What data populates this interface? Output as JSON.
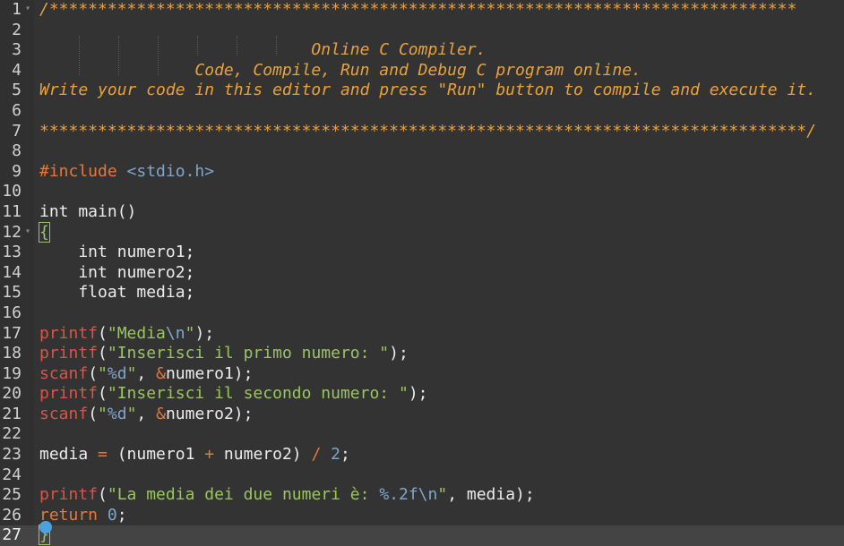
{
  "lines": [
    {
      "n": "1",
      "fold": true,
      "tokens": [
        {
          "t": "/*****************************************************************************",
          "c": "comment"
        }
      ]
    },
    {
      "n": "2",
      "tokens": []
    },
    {
      "n": "3",
      "tokens": [
        {
          "t": "                            Online C Compiler.",
          "c": "comment"
        }
      ]
    },
    {
      "n": "4",
      "tokens": [
        {
          "t": "                Code, Compile, Run and Debug C program online.",
          "c": "comment"
        }
      ]
    },
    {
      "n": "5",
      "tokens": [
        {
          "t": "Write your code in this editor and press \"Run\" button to compile and execute it.",
          "c": "comment"
        }
      ]
    },
    {
      "n": "6",
      "tokens": []
    },
    {
      "n": "7",
      "tokens": [
        {
          "t": "*******************************************************************************/",
          "c": "comment"
        }
      ]
    },
    {
      "n": "8",
      "tokens": []
    },
    {
      "n": "9",
      "tokens": [
        {
          "t": "#include ",
          "c": "pre"
        },
        {
          "t": "<stdio.h>",
          "c": "inc"
        }
      ]
    },
    {
      "n": "10",
      "tokens": []
    },
    {
      "n": "11",
      "tokens": [
        {
          "t": "int main()",
          "c": "plain"
        }
      ]
    },
    {
      "n": "12",
      "fold": true,
      "tokens": [
        {
          "t": "{",
          "c": "brace-g"
        }
      ]
    },
    {
      "n": "13",
      "tokens": [
        {
          "t": "    int numero1;",
          "c": "plain"
        }
      ]
    },
    {
      "n": "14",
      "tokens": [
        {
          "t": "    int numero2;",
          "c": "plain"
        }
      ]
    },
    {
      "n": "15",
      "tokens": [
        {
          "t": "    float media;",
          "c": "plain"
        }
      ]
    },
    {
      "n": "16",
      "tokens": []
    },
    {
      "n": "17",
      "tokens": [
        {
          "t": "printf",
          "c": "fn"
        },
        {
          "t": "(",
          "c": "plain"
        },
        {
          "t": "\"Media",
          "c": "str"
        },
        {
          "t": "\\n",
          "c": "esc"
        },
        {
          "t": "\"",
          "c": "str"
        },
        {
          "t": ");",
          "c": "plain"
        }
      ]
    },
    {
      "n": "18",
      "tokens": [
        {
          "t": "printf",
          "c": "fn"
        },
        {
          "t": "(",
          "c": "plain"
        },
        {
          "t": "\"Inserisci il primo numero: \"",
          "c": "str"
        },
        {
          "t": ");",
          "c": "plain"
        }
      ]
    },
    {
      "n": "19",
      "tokens": [
        {
          "t": "scanf",
          "c": "fn"
        },
        {
          "t": "(",
          "c": "plain"
        },
        {
          "t": "\"",
          "c": "str"
        },
        {
          "t": "%d",
          "c": "esc"
        },
        {
          "t": "\"",
          "c": "str"
        },
        {
          "t": ", ",
          "c": "plain"
        },
        {
          "t": "&",
          "c": "op"
        },
        {
          "t": "numero1);",
          "c": "plain"
        }
      ]
    },
    {
      "n": "20",
      "tokens": [
        {
          "t": "printf",
          "c": "fn"
        },
        {
          "t": "(",
          "c": "plain"
        },
        {
          "t": "\"Inserisci il secondo numero: \"",
          "c": "str"
        },
        {
          "t": ");",
          "c": "plain"
        }
      ]
    },
    {
      "n": "21",
      "tokens": [
        {
          "t": "scanf",
          "c": "fn"
        },
        {
          "t": "(",
          "c": "plain"
        },
        {
          "t": "\"",
          "c": "str"
        },
        {
          "t": "%d",
          "c": "esc"
        },
        {
          "t": "\"",
          "c": "str"
        },
        {
          "t": ", ",
          "c": "plain"
        },
        {
          "t": "&",
          "c": "op"
        },
        {
          "t": "numero2);",
          "c": "plain"
        }
      ]
    },
    {
      "n": "22",
      "tokens": []
    },
    {
      "n": "23",
      "tokens": [
        {
          "t": "media ",
          "c": "plain"
        },
        {
          "t": "=",
          "c": "op"
        },
        {
          "t": " (numero1 ",
          "c": "plain"
        },
        {
          "t": "+",
          "c": "op"
        },
        {
          "t": " numero2) ",
          "c": "plain"
        },
        {
          "t": "/",
          "c": "op"
        },
        {
          "t": " ",
          "c": "plain"
        },
        {
          "t": "2",
          "c": "num"
        },
        {
          "t": ";",
          "c": "plain"
        }
      ]
    },
    {
      "n": "24",
      "tokens": []
    },
    {
      "n": "25",
      "tokens": [
        {
          "t": "printf",
          "c": "fn"
        },
        {
          "t": "(",
          "c": "plain"
        },
        {
          "t": "\"La media dei due numeri è: ",
          "c": "str"
        },
        {
          "t": "%.2f",
          "c": "esc"
        },
        {
          "t": "\\n",
          "c": "esc"
        },
        {
          "t": "\"",
          "c": "str"
        },
        {
          "t": ", media);",
          "c": "plain"
        }
      ]
    },
    {
      "n": "26",
      "tokens": [
        {
          "t": "return ",
          "c": "kw"
        },
        {
          "t": "0",
          "c": "num"
        },
        {
          "t": ";",
          "c": "plain"
        }
      ]
    },
    {
      "n": "27",
      "active": true,
      "tokens": [
        {
          "t": "}",
          "c": "brace-g"
        }
      ]
    }
  ]
}
